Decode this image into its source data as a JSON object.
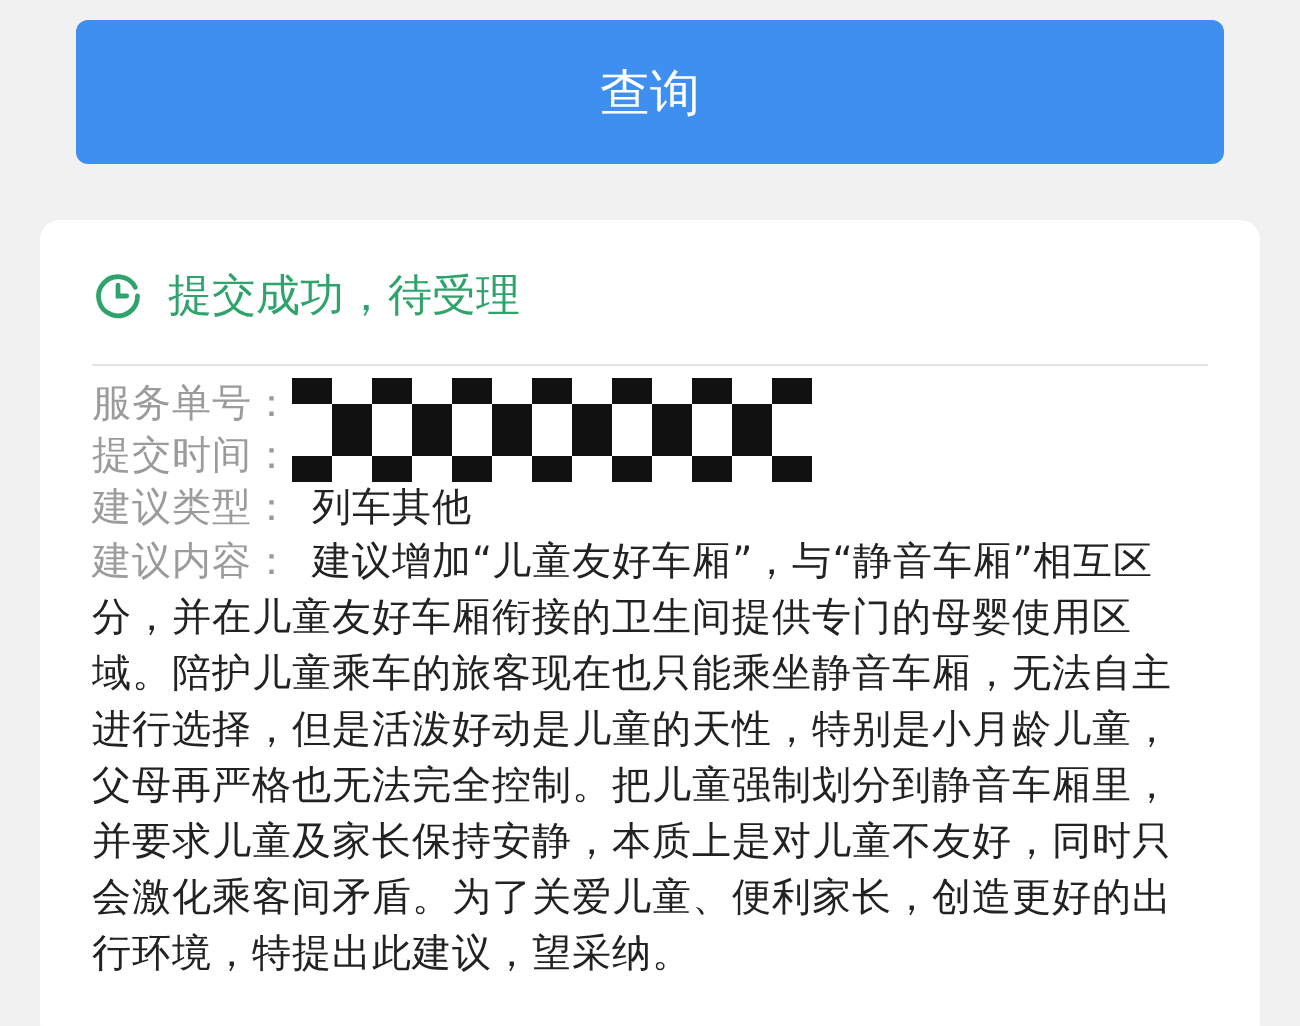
{
  "query_button": {
    "label": "查询"
  },
  "status": {
    "text": "提交成功，待受理"
  },
  "fields": [
    {
      "kind": "redacted",
      "label": "服务单号："
    },
    {
      "kind": "redacted",
      "label": "提交时间："
    },
    {
      "kind": "text",
      "label": "建议类型：",
      "value": "列车其他"
    },
    {
      "kind": "paragraph",
      "label": "建议内容：",
      "value": "建议增加“儿童友好车厢”，与“静音车厢”相互区分，并在儿童友好车厢衔接的卫生间提供专门的母婴使用区域。陪护儿童乘车的旅客现在也只能乘坐静音车厢，无法自主进行选择，但是活泼好动是儿童的天性，特别是小月龄儿童，父母再严格也无法完全控制。把儿童强制划分到静音车厢里，并要求儿童及家长保持安静，本质上是对儿童不友好，同时只会激化乘客间矛盾。为了关爱儿童、便利家长，创造更好的出行环境，特提出此建议，望采纳。"
    }
  ]
}
